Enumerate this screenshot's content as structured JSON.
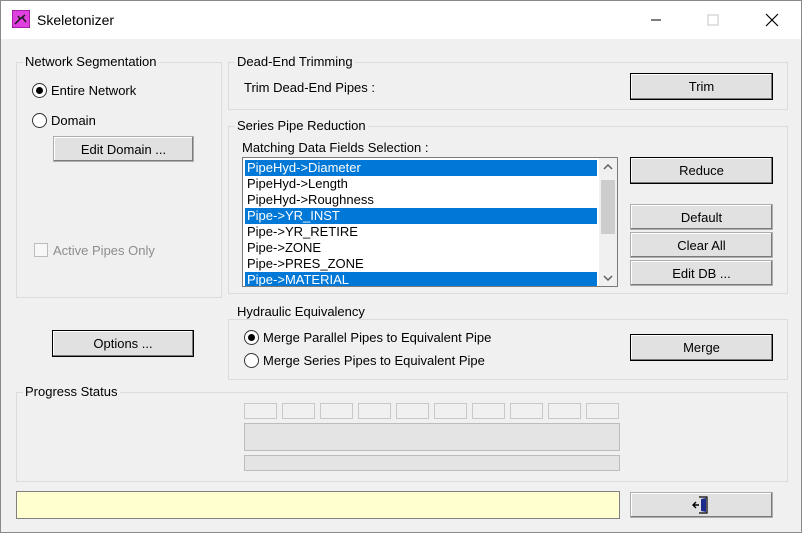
{
  "window": {
    "title": "Skeletonizer"
  },
  "segmentation": {
    "label": "Network Segmentation",
    "entire_network": "Entire Network",
    "domain": "Domain",
    "edit_domain": "Edit Domain ...",
    "active_pipes_only": "Active Pipes Only"
  },
  "options_button": "Options ...",
  "dead_end": {
    "label": "Dead-End Trimming",
    "trim_label": "Trim Dead-End Pipes :",
    "trim_button": "Trim"
  },
  "series": {
    "label": "Series Pipe Reduction",
    "fields_label": "Matching Data Fields Selection :",
    "items": [
      {
        "text": "PipeHyd->Diameter",
        "selected": true
      },
      {
        "text": "PipeHyd->Length",
        "selected": false
      },
      {
        "text": "PipeHyd->Roughness",
        "selected": false
      },
      {
        "text": "Pipe->YR_INST",
        "selected": true
      },
      {
        "text": "Pipe->YR_RETIRE",
        "selected": false
      },
      {
        "text": "Pipe->ZONE",
        "selected": false
      },
      {
        "text": "Pipe->PRES_ZONE",
        "selected": false
      },
      {
        "text": "Pipe->MATERIAL",
        "selected": true
      }
    ],
    "reduce_button": "Reduce",
    "default_button": "Default",
    "clear_all_button": "Clear All",
    "edit_db_button": "Edit DB ..."
  },
  "hydraulic": {
    "label": "Hydraulic Equivalency",
    "parallel": "Merge Parallel Pipes to Equivalent Pipe",
    "series": "Merge Series Pipes to Equivalent Pipe",
    "merge_button": "Merge"
  },
  "progress": {
    "label": "Progress Status"
  },
  "colors": {
    "selection": "#0078d7",
    "status_field": "#ffffd0",
    "app_icon": "#e040e0"
  },
  "icons": {
    "app": "skeleton-app-icon",
    "exit": "exit-door-icon"
  }
}
